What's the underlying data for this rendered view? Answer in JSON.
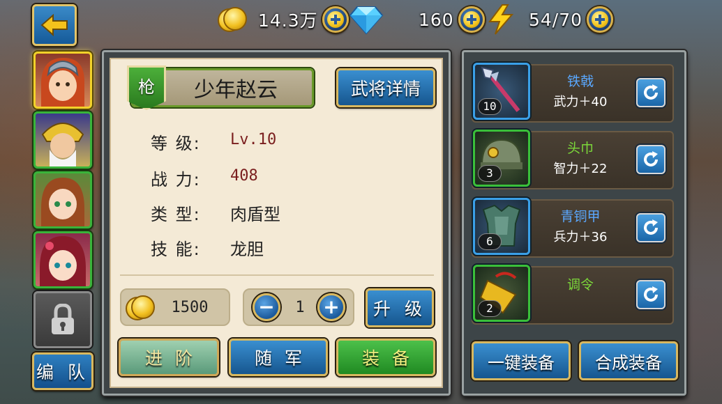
{
  "topbar": {
    "gold": "14.3万",
    "diamonds": "160",
    "energy": "54/70"
  },
  "left_bar": {
    "team_label": "编 队"
  },
  "hero": {
    "weapon_type": "枪",
    "name": "少年赵云",
    "details_label": "武将详情",
    "stats": [
      {
        "label": "等  级:",
        "value": "Lv.10"
      },
      {
        "label": "战  力:",
        "value": "408"
      },
      {
        "label": "类  型:",
        "value": "肉盾型"
      },
      {
        "label": "技  能:",
        "value": "龙胆"
      }
    ]
  },
  "upgrade": {
    "cost": "1500",
    "quantity": "1",
    "minus": "−",
    "plus": "+",
    "upgrade_label": "升 级"
  },
  "actions": {
    "advance": "进阶",
    "follow": "随军",
    "equip": "装备"
  },
  "equipment": [
    {
      "name": "铁戟",
      "stat": "武力＋40",
      "level": "10",
      "rarity": "blue",
      "icon": "halberd-icon"
    },
    {
      "name": "头巾",
      "stat": "智力＋22",
      "level": "3",
      "rarity": "green",
      "icon": "helmet-icon"
    },
    {
      "name": "青铜甲",
      "stat": "兵力＋36",
      "level": "6",
      "rarity": "blue",
      "icon": "armor-icon"
    },
    {
      "name": "调令",
      "stat": "",
      "level": "2",
      "rarity": "green",
      "icon": "token-icon"
    }
  ],
  "equip_panel": {
    "one_click": "一键装备",
    "synthesize": "合成装备"
  },
  "colors": {
    "accent_gold": "#d8b860",
    "button_blue": "#16568f",
    "rarity_blue": "#3aa0e8",
    "rarity_green": "#3ac03a",
    "power_red": "#7a1e1e"
  }
}
